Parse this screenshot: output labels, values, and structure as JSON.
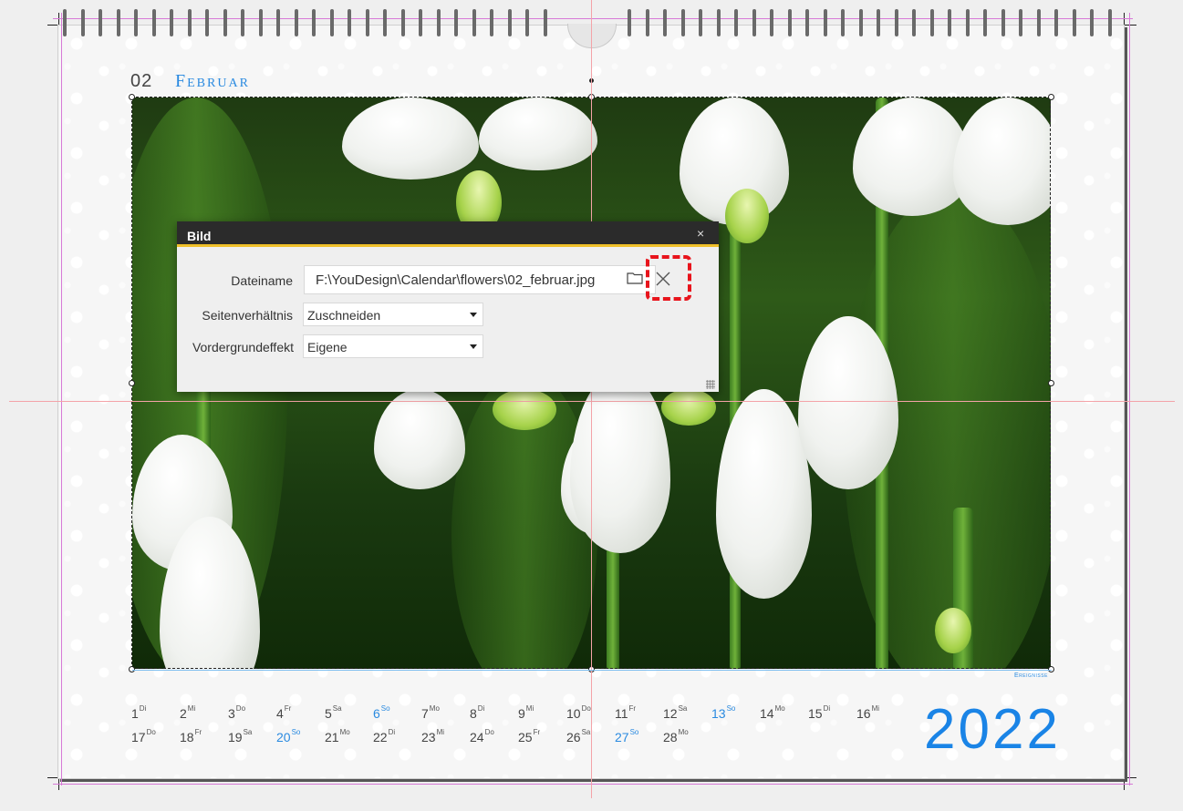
{
  "calendar": {
    "month_number": "02",
    "month_name": "Februar",
    "year": "2022",
    "events_label": "Ereignisse",
    "days": [
      {
        "d": "1",
        "w": "Di"
      },
      {
        "d": "2",
        "w": "Mi"
      },
      {
        "d": "3",
        "w": "Do"
      },
      {
        "d": "4",
        "w": "Fr"
      },
      {
        "d": "5",
        "w": "Sa"
      },
      {
        "d": "6",
        "w": "So",
        "sun": true
      },
      {
        "d": "7",
        "w": "Mo"
      },
      {
        "d": "8",
        "w": "Di"
      },
      {
        "d": "9",
        "w": "Mi"
      },
      {
        "d": "10",
        "w": "Do"
      },
      {
        "d": "11",
        "w": "Fr"
      },
      {
        "d": "12",
        "w": "Sa"
      },
      {
        "d": "13",
        "w": "So",
        "sun": true
      },
      {
        "d": "14",
        "w": "Mo"
      },
      {
        "d": "15",
        "w": "Di"
      },
      {
        "d": "16",
        "w": "Mi"
      },
      {
        "d": "17",
        "w": "Do"
      },
      {
        "d": "18",
        "w": "Fr"
      },
      {
        "d": "19",
        "w": "Sa"
      },
      {
        "d": "20",
        "w": "So",
        "sun": true
      },
      {
        "d": "21",
        "w": "Mo"
      },
      {
        "d": "22",
        "w": "Di"
      },
      {
        "d": "23",
        "w": "Mi"
      },
      {
        "d": "24",
        "w": "Do"
      },
      {
        "d": "25",
        "w": "Fr"
      },
      {
        "d": "26",
        "w": "Sa"
      },
      {
        "d": "27",
        "w": "So",
        "sun": true
      },
      {
        "d": "28",
        "w": "Mo"
      }
    ],
    "accent_color": "#1a84e6"
  },
  "dialog": {
    "title": "Bild",
    "close_glyph": "×",
    "filename_label": "Dateiname",
    "filename_value": "F:\\YouDesign\\Calendar\\flowers\\02_februar.jpg",
    "aspect_label": "Seitenverhältnis",
    "aspect_value": "Zuschneiden",
    "foreground_label": "Vordergrundeffekt",
    "foreground_value": "Eigene",
    "folder_icon": "folder-icon",
    "clear_icon": "clear-x-icon",
    "title_accent": "#f0c02a",
    "highlight_color": "#e8141c"
  }
}
